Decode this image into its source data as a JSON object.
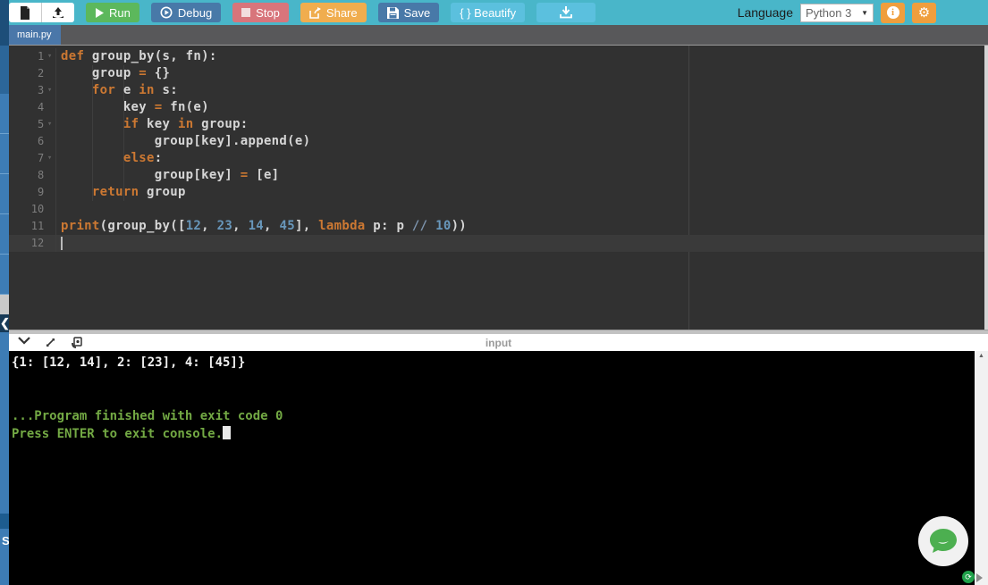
{
  "colors": {
    "toolbar_bg": "#49b6c9",
    "run_green": "#5cb85c",
    "debug_blue": "#4879a8",
    "stop_red": "#d8757b",
    "share_orange": "#f0ad4e",
    "beautify_teal": "#5bc0de",
    "icon_orange": "#ef9e3d",
    "tab_blue": "#4a77a9",
    "tabbar_gray": "#58585a",
    "editor_bg": "#313131",
    "keyword_orange": "#cc7832",
    "number_blue": "#6897bb",
    "console_green": "#73a944",
    "console_bg": "#000000"
  },
  "toolbar": {
    "run": {
      "label": "Run"
    },
    "debug": {
      "label": "Debug"
    },
    "stop": {
      "label": "Stop"
    },
    "share": {
      "label": "Share"
    },
    "save": {
      "label": "Save"
    },
    "beautify": {
      "label": "{ } Beautify"
    },
    "language_label": "Language",
    "language_value": "Python 3",
    "icons": [
      "new-file-icon",
      "open-file-icon",
      "play-icon",
      "debug-icon",
      "stop-icon",
      "share-icon",
      "save-icon",
      "download-icon",
      "info-icon",
      "gear-icon"
    ]
  },
  "tab": {
    "name": "main.py"
  },
  "sidebar": {
    "collapse_chevron": "❮",
    "fragment": "S"
  },
  "editor": {
    "cursor_line": 12,
    "lines": [
      {
        "n": 1,
        "fold": true,
        "tokens": [
          [
            "k",
            "def"
          ],
          [
            "p",
            " group_by(s, fn):"
          ]
        ]
      },
      {
        "n": 2,
        "fold": false,
        "tokens": [
          [
            "p",
            "    group "
          ],
          [
            "o",
            "="
          ],
          [
            "p",
            " {}"
          ]
        ]
      },
      {
        "n": 3,
        "fold": true,
        "tokens": [
          [
            "p",
            "    "
          ],
          [
            "k",
            "for"
          ],
          [
            "p",
            " e "
          ],
          [
            "k",
            "in"
          ],
          [
            "p",
            " s:"
          ]
        ]
      },
      {
        "n": 4,
        "fold": false,
        "tokens": [
          [
            "p",
            "        key "
          ],
          [
            "o",
            "="
          ],
          [
            "p",
            " fn(e)"
          ]
        ]
      },
      {
        "n": 5,
        "fold": true,
        "tokens": [
          [
            "p",
            "        "
          ],
          [
            "k",
            "if"
          ],
          [
            "p",
            " key "
          ],
          [
            "k",
            "in"
          ],
          [
            "p",
            " group:"
          ]
        ]
      },
      {
        "n": 6,
        "fold": false,
        "tokens": [
          [
            "p",
            "            group[key].append(e)"
          ]
        ]
      },
      {
        "n": 7,
        "fold": true,
        "tokens": [
          [
            "p",
            "        "
          ],
          [
            "k",
            "else"
          ],
          [
            "p",
            ":"
          ]
        ]
      },
      {
        "n": 8,
        "fold": false,
        "tokens": [
          [
            "p",
            "            group[key] "
          ],
          [
            "o",
            "="
          ],
          [
            "p",
            " [e]"
          ]
        ]
      },
      {
        "n": 9,
        "fold": false,
        "tokens": [
          [
            "p",
            "    "
          ],
          [
            "k",
            "return"
          ],
          [
            "p",
            " group"
          ]
        ]
      },
      {
        "n": 10,
        "fold": false,
        "tokens": []
      },
      {
        "n": 11,
        "fold": false,
        "tokens": [
          [
            "k",
            "print"
          ],
          [
            "p",
            "(group_by(["
          ],
          [
            "n",
            "12"
          ],
          [
            "p",
            ", "
          ],
          [
            "n",
            "23"
          ],
          [
            "p",
            ", "
          ],
          [
            "n",
            "14"
          ],
          [
            "p",
            ", "
          ],
          [
            "n",
            "45"
          ],
          [
            "p",
            "], "
          ],
          [
            "k",
            "lambda"
          ],
          [
            "p",
            " p: p "
          ],
          [
            "d",
            "//"
          ],
          [
            "p",
            " "
          ],
          [
            "n",
            "10"
          ],
          [
            "p",
            "))"
          ]
        ]
      },
      {
        "n": 12,
        "fold": false,
        "tokens": []
      }
    ]
  },
  "console_bar": {
    "title": "input"
  },
  "console": {
    "lines": [
      {
        "text": "{1: [12, 14], 2: [23], 4: [45]}",
        "type": "stdout",
        "cursor": false
      },
      {
        "text": "",
        "type": "stdout",
        "cursor": false
      },
      {
        "text": "",
        "type": "stdout",
        "cursor": false
      },
      {
        "text": "...Program finished with exit code 0",
        "type": "status",
        "cursor": false
      },
      {
        "text": "Press ENTER to exit console.",
        "type": "status",
        "cursor": true
      }
    ]
  }
}
